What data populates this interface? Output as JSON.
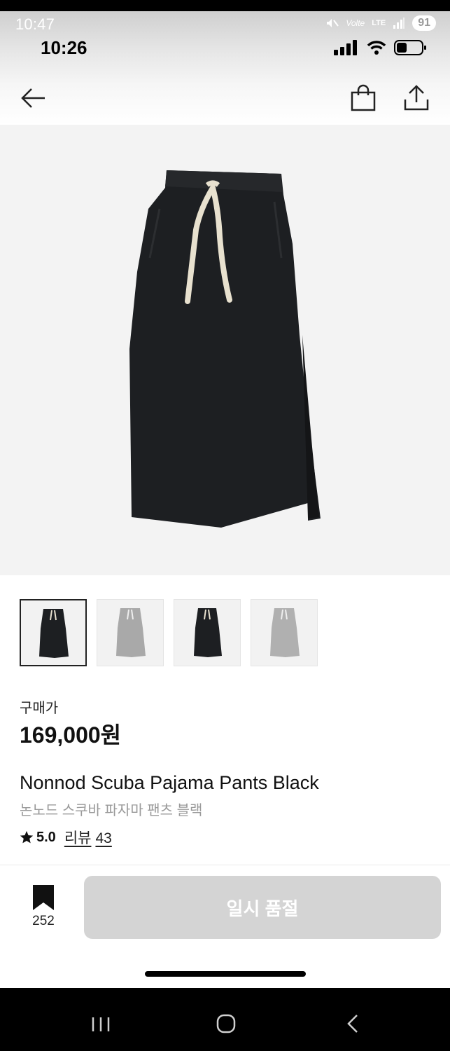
{
  "status_bar": {
    "outer_time": "10:47",
    "outer_network": "Volte",
    "outer_lte": "LTE",
    "outer_battery": "91",
    "inner_time": "10:26"
  },
  "nav": {
    "back_icon": "arrow-left-icon",
    "cart_icon": "shopping-bag-icon",
    "share_icon": "share-icon"
  },
  "product": {
    "image": "black-pants-photo",
    "thumbnails": [
      "black-pants",
      "grey-pants",
      "black-pants",
      "grey-pants"
    ],
    "price_label": "구매가",
    "price": "169,000원",
    "name_en": "Nonnod Scuba Pajama Pants Black",
    "name_ko": "논노드 스쿠바 파자마 팬츠 블랙",
    "rating": "5.0",
    "review_label": "리뷰",
    "review_count": "43"
  },
  "bottom_bar": {
    "bookmark_count": "252",
    "soldout_label": "일시 품절"
  },
  "colors": {
    "soldout_bg": "#d4d4d4",
    "hero_bg": "#f3f3f3",
    "text_muted": "#9a9a9a"
  }
}
